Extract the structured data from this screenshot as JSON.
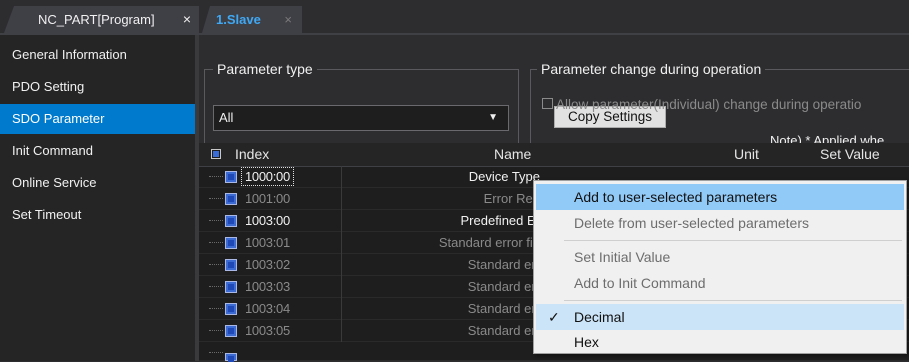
{
  "tabs": [
    {
      "label": "NC_PART[Program]",
      "close": "×"
    },
    {
      "label": "1.Slave",
      "close": "×"
    }
  ],
  "sidebar": {
    "items": [
      {
        "label": "General Information",
        "active": false
      },
      {
        "label": "PDO Setting",
        "active": false
      },
      {
        "label": "SDO Parameter",
        "active": true
      },
      {
        "label": "Init Command",
        "active": false
      },
      {
        "label": "Online Service",
        "active": false
      },
      {
        "label": "Set Timeout",
        "active": false
      }
    ]
  },
  "param_type": {
    "title": "Parameter type",
    "selected": "All"
  },
  "param_change": {
    "title": "Parameter change during operation",
    "allow_label": "Allow parameter(Individual) change during operatio",
    "copy_button": "Copy Settings",
    "note": "Note) * Applied whe"
  },
  "table": {
    "headers": {
      "index": "Index",
      "name": "Name",
      "unit": "Unit",
      "set_value": "Set Value"
    },
    "rows": [
      {
        "index": "1000:00",
        "name": "Device Type",
        "dim": false
      },
      {
        "index": "1001:00",
        "name": "Error Reg",
        "dim": true
      },
      {
        "index": "1003:00",
        "name": "Predefined Er",
        "dim": false
      },
      {
        "index": "1003:01",
        "name": "Standard error fie",
        "dim": true
      },
      {
        "index": "1003:02",
        "name": "Standard err",
        "dim": true
      },
      {
        "index": "1003:03",
        "name": "Standard err",
        "dim": true
      },
      {
        "index": "1003:04",
        "name": "Standard err",
        "dim": true
      },
      {
        "index": "1003:05",
        "name": "Standard err",
        "dim": true
      }
    ]
  },
  "context_menu": {
    "add_selected": "Add to user-selected parameters",
    "delete_selected": "Delete from user-selected parameters",
    "set_initial": "Set Initial Value",
    "add_init": "Add to Init Command",
    "decimal": "Decimal",
    "hex": "Hex",
    "check_mark": "✓"
  },
  "colors": {
    "accent": "#007acc",
    "tab_active_text": "#3fa9f5",
    "menu_highlight": "#91c9f7"
  }
}
